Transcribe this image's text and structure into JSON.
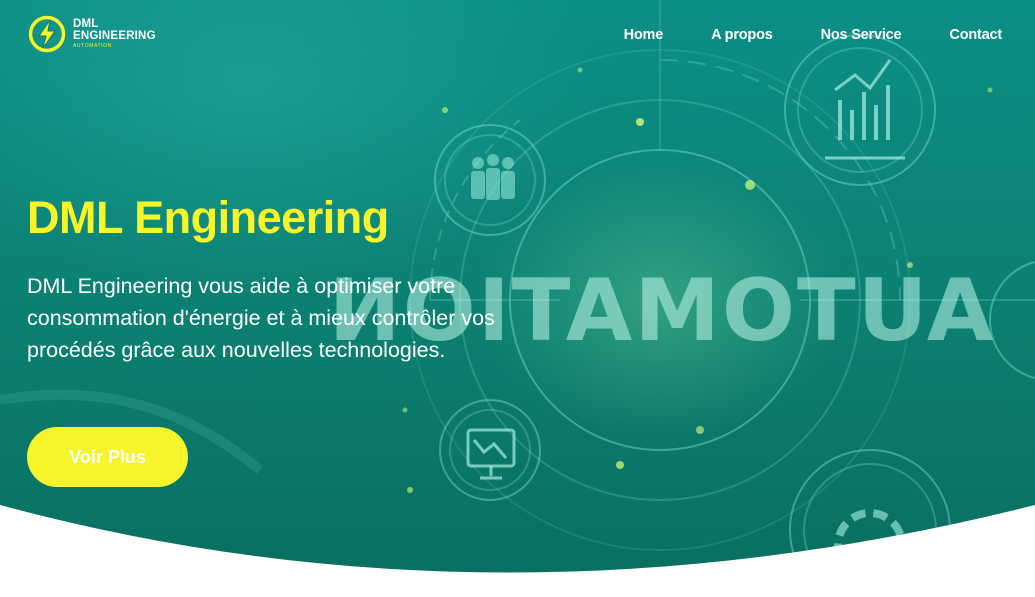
{
  "brand": {
    "name_line1": "DML",
    "name_line2": "ENGINEERING",
    "tagline": "AUTOMATION",
    "logo_icon": "lightning-bolt-icon",
    "accent_color": "#f6f42a"
  },
  "nav": {
    "items": [
      {
        "label": "Home"
      },
      {
        "label": "A propos"
      },
      {
        "label": "Nos Service"
      },
      {
        "label": "Contact"
      }
    ]
  },
  "hero": {
    "title": "DML Engineering",
    "description": "DML Engineering vous aide à optimiser votre consommation d'énergie et à mieux contrôler vos procédés grâce aux nouvelles technologies.",
    "cta_label": "Voir Plus",
    "background_text": "AUTOMATION",
    "background_color": "#0b7f70",
    "background_icons": [
      "team-icon",
      "bar-chart-icon",
      "monitor-chart-icon",
      "gear-icon"
    ]
  }
}
